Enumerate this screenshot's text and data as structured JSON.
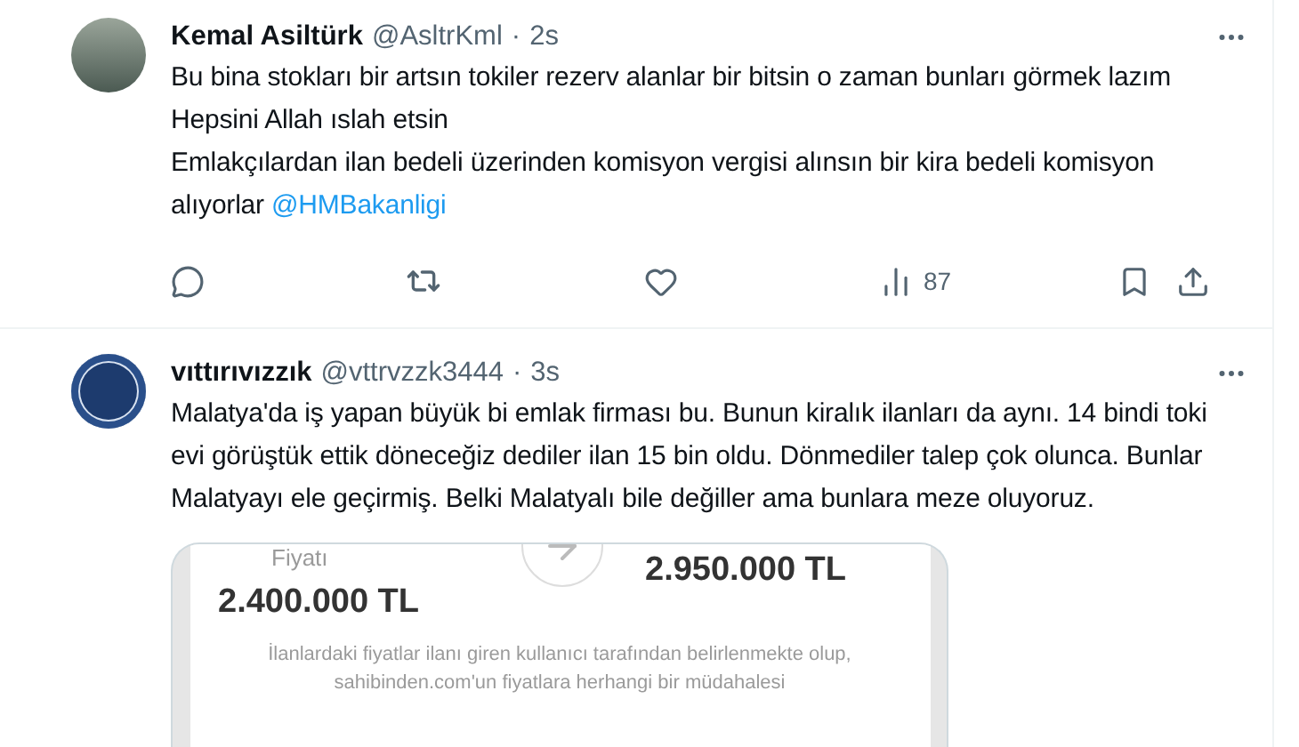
{
  "tweets": [
    {
      "name": "Kemal Asiltürk",
      "handle": "@AsltrKml",
      "separator": "·",
      "time": "2s",
      "paragraphs": [
        {
          "text": "Bu bina stokları bir artsın tokiler rezerv alanlar bir bitsin o zaman bunları görmek lazım Hepsini Allah ıslah etsin"
        },
        {
          "text": "Emlakçılardan ilan bedeli üzerinden komisyon vergisi alınsın bir kira bedeli komisyon alıyorlar",
          "mention": "@HMBakanligi"
        }
      ],
      "views": "87"
    },
    {
      "name": "vıttırıvızzık",
      "handle": "@vttrvzzk3444",
      "separator": "·",
      "time": "3s",
      "paragraphs": [
        {
          "text": "Malatya'da iş yapan büyük bi emlak firması bu. Bunun kiralık ilanları da aynı. 14 bindi toki evi görüştük ettik döneceğiz dediler ilan 15 bin oldu. Dönmediler talep çok olunca. Bunlar Malatyayı ele geçirmiş. Belki Malatyalı bile değiller ama bunlara meze oluyoruz."
        }
      ],
      "image": {
        "price_label": "Fiyatı",
        "old_price": "2.400.000 TL",
        "new_price": "2.950.000 TL",
        "disclaimer": "İlanlardaki fiyatlar ilanı giren kullanıcı tarafından belirlenmekte olup, sahibinden.com'un fiyatlara herhangi bir müdahalesi"
      }
    }
  ]
}
